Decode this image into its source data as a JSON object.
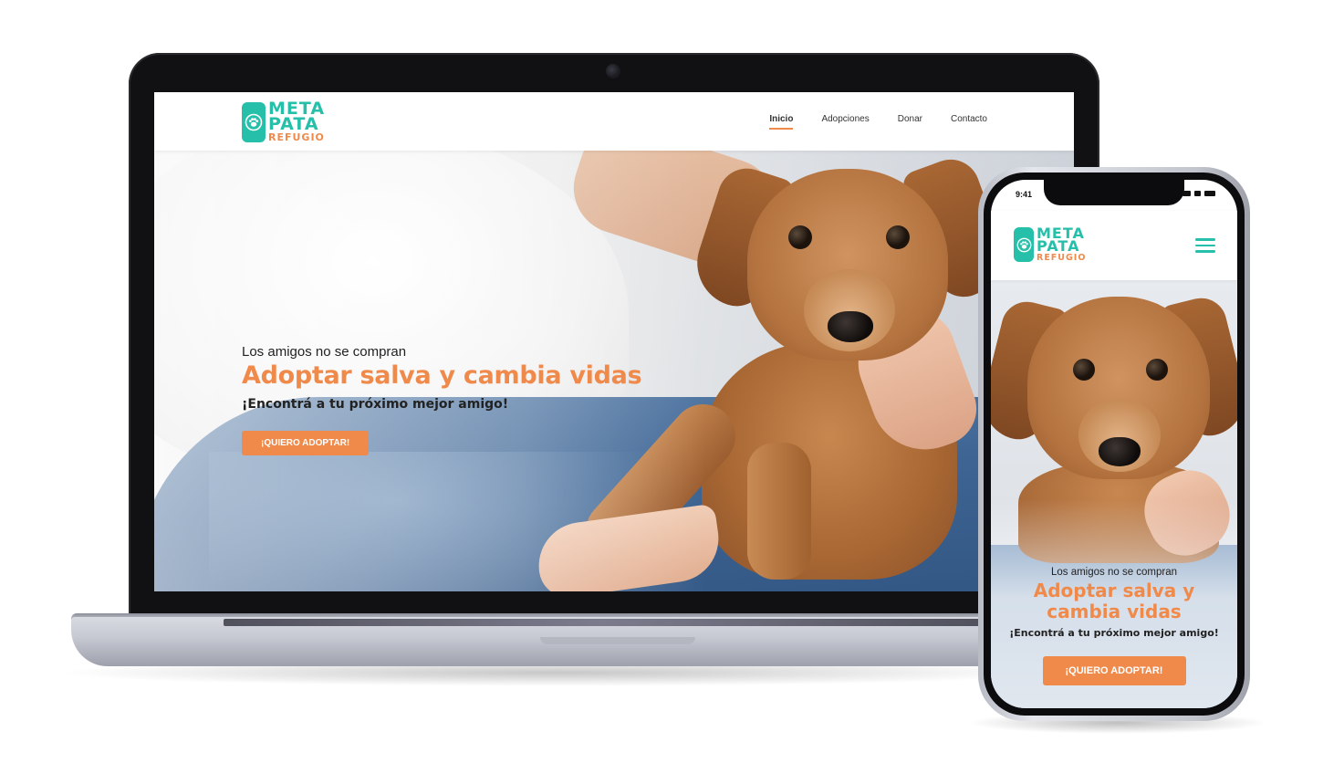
{
  "laptop": {
    "logo": {
      "line1": "META",
      "line2": "PATA",
      "line3": "REFUGIO"
    },
    "nav": [
      {
        "label": "Inicio",
        "active": true
      },
      {
        "label": "Adopciones",
        "active": false
      },
      {
        "label": "Donar",
        "active": false
      },
      {
        "label": "Contacto",
        "active": false
      }
    ],
    "hero": {
      "kicker": "Los amigos no se compran",
      "title": "Adoptar salva y cambia vidas",
      "subtitle": "¡Encontrá a tu próximo mejor amigo!",
      "cta": "¡QUIERO ADOPTAR!"
    }
  },
  "phone": {
    "status_time": "9:41",
    "logo": {
      "line1": "META",
      "line2": "PATA",
      "line3": "REFUGIO"
    },
    "hero": {
      "kicker": "Los amigos no se compran",
      "title_line1": "Adoptar salva y",
      "title_line2": "cambia vidas",
      "subtitle": "¡Encontrá a tu próximo mejor amigo!",
      "cta": "¡QUIERO ADOPTAR!"
    }
  },
  "colors": {
    "teal": "#26bfa9",
    "orange": "#f08a4b",
    "text": "#222222"
  },
  "icons": {
    "logo": "paw-icon",
    "menu": "hamburger-icon"
  }
}
